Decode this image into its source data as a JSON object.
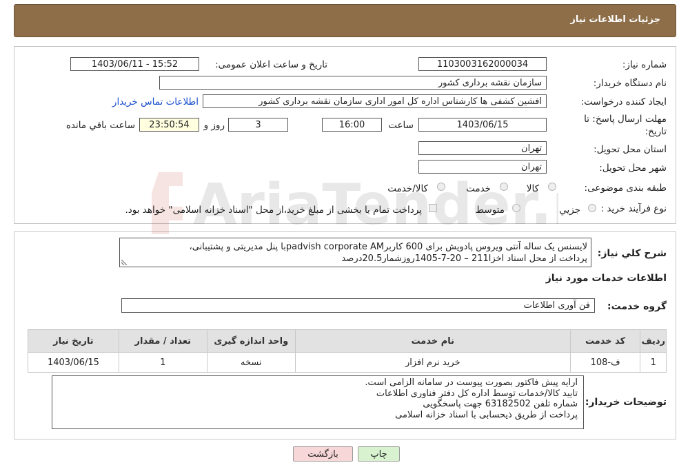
{
  "header": {
    "title": "جزئیات اطلاعات نیاز"
  },
  "form": {
    "need_number_label": "شماره نیاز:",
    "need_number": "1103003162000034",
    "announce_label": "تاریخ و ساعت اعلان عمومی:",
    "announce_value": "1403/06/11 - 15:52",
    "buyer_org_label": "نام دستگاه خریدار:",
    "buyer_org": "سازمان نقشه برداری کشور",
    "creator_label": "ایجاد کننده درخواست:",
    "creator": "افشین کشفی ها کارشناس اداره کل امور اداری سازمان نقشه برداری کشور",
    "contact_link": "اطلاعات تماس خریدار",
    "deadline_label_1": "مهلت ارسال پاسخ: تا",
    "deadline_label_2": "تاریخ:",
    "deadline_date": "1403/06/15",
    "time_label": "ساعت",
    "deadline_time": "16:00",
    "days_value": "3",
    "days_label": "روز و",
    "remaining_time": "23:50:54",
    "remaining_label": "ساعت باقي مانده",
    "province_label": "استان محل تحویل:",
    "province": "تهران",
    "city_label": "شهر محل تحویل:",
    "city": "تهران",
    "category_label": "طبقه بندی موضوعی:",
    "category_options": [
      {
        "label": "کالا",
        "selected": false
      },
      {
        "label": "خدمت",
        "selected": false
      },
      {
        "label": "کالا/خدمت",
        "selected": false
      }
    ],
    "purchase_type_label": "نوع فرآیند خرید :",
    "purchase_options": [
      {
        "label": "جزیي",
        "selected": false
      },
      {
        "label": "متوسط",
        "selected": false
      }
    ],
    "payment_note": "پرداخت تمام یا بخشی از مبلغ خرید،از محل \"اسناد خزانه اسلامی\" خواهد بود."
  },
  "details": {
    "summary_label": "شرح کلي نياز:",
    "summary_line1": "لایسنس یک ساله آنتی ویروس پادویش برای 600 کاربرpadvish corporate AMبا پنل مدیریتی و پشتیبانی،",
    "summary_line2": "پرداخت از محل اسناد اخزا211 – 20-7-1405روزشمار20.5درصد",
    "services_heading": "اطلاعات خدمات مورد نیاز",
    "service_group_label": "گروه خدمت:",
    "service_group": "فن آوری اطلاعات",
    "table": {
      "columns": [
        "ردیف",
        "کد خدمت",
        "نام خدمت",
        "واحد اندازه گیری",
        "تعداد / مقدار",
        "تاریخ نیاز"
      ],
      "rows": [
        [
          "1",
          "ف-108",
          "خرید نرم افزار",
          "نسخه",
          "1",
          "1403/06/15"
        ]
      ]
    },
    "buyer_notes_label": "توضیحات خریدار:",
    "buyer_notes": [
      "ارایه پیش فاکتور بصورت پیوست در سامانه الزامی است.",
      "تایید کالا/خدمات توسط اداره کل دفتر فناوری اطلاعات",
      "شماره تلفن 63182502 جهت پاسخگویی",
      "پرداخت از طریق ذیحسابی با اسناد خزانه اسلامی"
    ]
  },
  "buttons": {
    "print": "چاپ",
    "back": "بازگشت"
  },
  "watermark": {
    "text": "AriaTender.net"
  },
  "colors": {
    "header_bg": "#8d6e48",
    "link": "#1a4fd0",
    "remaining_bg": "#ffffe0",
    "back_btn": "#f7d7d7",
    "print_btn": "#d8f2d0"
  }
}
